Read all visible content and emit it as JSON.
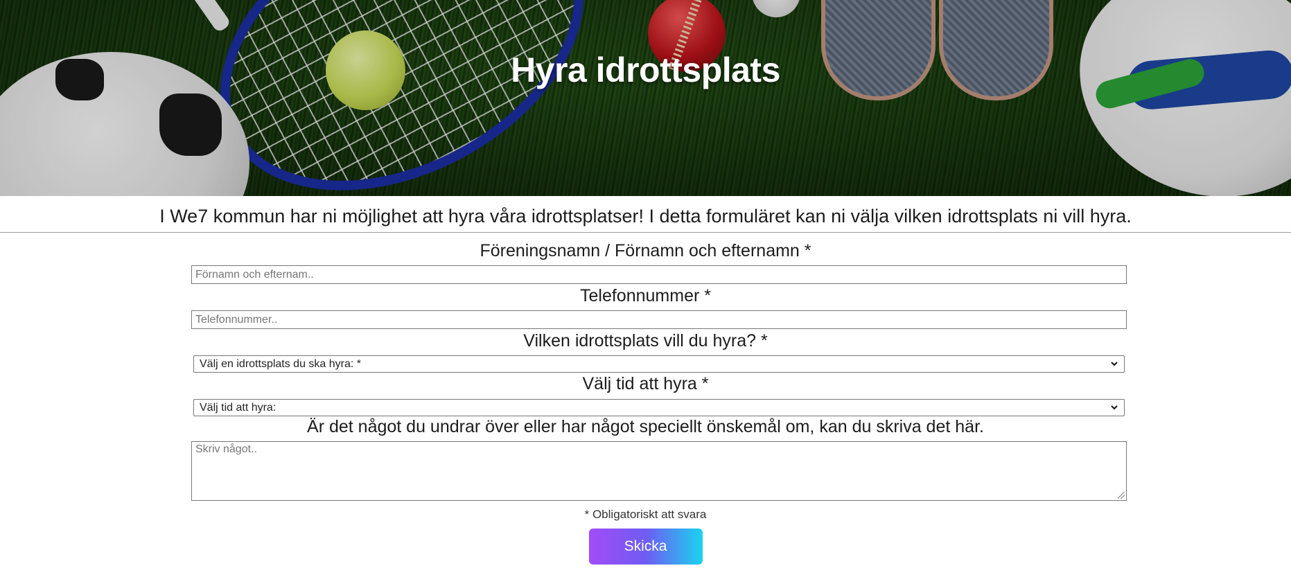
{
  "hero": {
    "title": "Hyra idrottsplats"
  },
  "intro": {
    "text": "I We7 kommun har ni möjlighet att hyra våra idrottsplatser! I detta formuläret kan ni välja vilken idrottsplats ni vill hyra."
  },
  "form": {
    "name": {
      "label": "Föreningsnamn / Förnamn och efternamn *",
      "placeholder": "Förnamn och efternam..",
      "value": ""
    },
    "phone": {
      "label": "Telefonnummer *",
      "placeholder": "Telefonnummer..",
      "value": ""
    },
    "venue": {
      "label": "Vilken idrottsplats vill du hyra? *",
      "selected": "Välj en idrottsplats du ska hyra: *"
    },
    "time": {
      "label": "Välj tid att hyra *",
      "selected": "Välj tid att hyra:"
    },
    "message": {
      "label": "Är det något du undrar över eller har något speciellt önskemål om, kan du skriva det här.",
      "placeholder": "Skriv något..",
      "value": ""
    },
    "required_note": "* Obligatoriskt att svara",
    "submit_label": "Skicka"
  },
  "icons": {
    "select_arrow": "chevron-down-icon",
    "textarea_resize": "resize-grip-icon"
  },
  "colors": {
    "submit_gradient_start": "#a24cf7",
    "submit_gradient_end": "#1ad3f0",
    "title_text": "#ffffff"
  }
}
